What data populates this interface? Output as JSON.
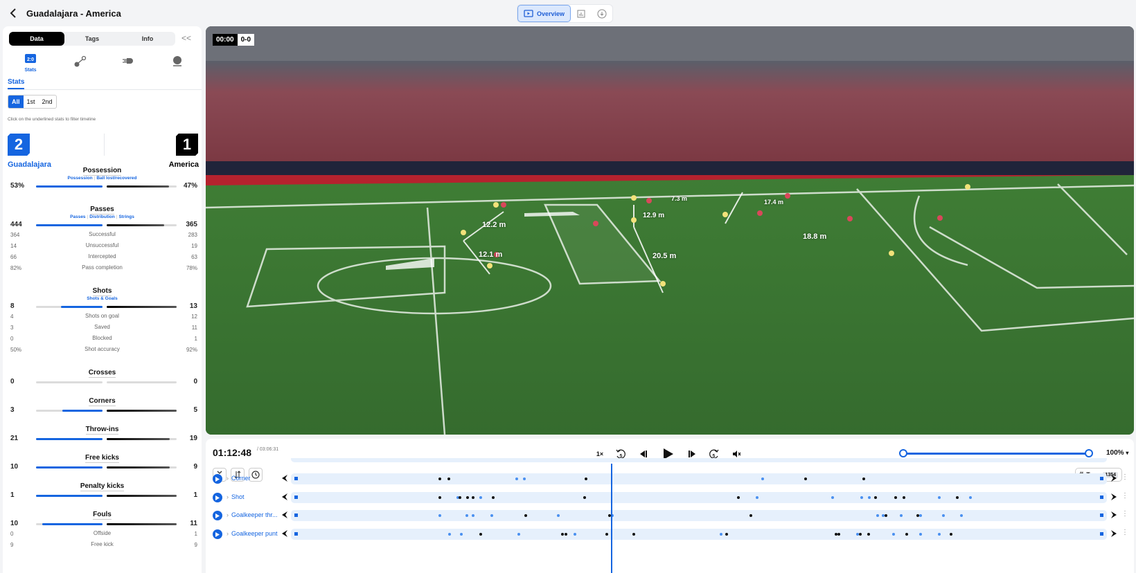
{
  "header": {
    "title": "Guadalajara - America",
    "back_label": "back"
  },
  "view_toggle": {
    "overview_label": "Overview",
    "active": "overview"
  },
  "left_panel": {
    "tabs": [
      {
        "label": "Data",
        "active": true
      },
      {
        "label": "Tags",
        "active": false
      },
      {
        "label": "Info",
        "active": false
      }
    ],
    "collapse_label": "<<",
    "categories": [
      {
        "name": "stats",
        "label": "Stats",
        "active": true
      },
      {
        "name": "passing-network"
      },
      {
        "name": "speed"
      },
      {
        "name": "player"
      }
    ],
    "section_tab": "Stats",
    "periods": [
      {
        "label": "All",
        "active": true
      },
      {
        "label": "1st",
        "active": false
      },
      {
        "label": "2nd",
        "active": false
      }
    ],
    "hint": "Click on the underlined stats to filter timeline",
    "score": {
      "home": "2",
      "away": "1",
      "home_team": "Guadalajara",
      "away_team": "America",
      "home_color": "#1565e0",
      "away_color": "#000000"
    },
    "stats": {
      "possession": {
        "title": "Possession",
        "links": [
          "Possession",
          "Ball lost/recovered"
        ],
        "home": "53%",
        "away": "47%",
        "home_frac": 1.0,
        "away_frac": 0.89
      },
      "passes": {
        "title": "Passes",
        "links": [
          "Passes",
          "Distribution",
          "Strings"
        ],
        "home": "444",
        "away": "365",
        "home_frac": 1.0,
        "away_frac": 0.82,
        "rows": [
          {
            "label": "Successful",
            "home": "364",
            "away": "283"
          },
          {
            "label": "Unsuccessful",
            "home": "14",
            "away": "19"
          },
          {
            "label": "Intercepted",
            "home": "66",
            "away": "63"
          },
          {
            "label": "Pass completion",
            "home": "82%",
            "away": "78%"
          }
        ]
      },
      "shots": {
        "title": "Shots",
        "links": [
          "Shots & Goals"
        ],
        "home": "8",
        "away": "13",
        "home_frac": 0.62,
        "away_frac": 1.0,
        "rows": [
          {
            "label": "Shots on goal",
            "home": "4",
            "away": "12"
          },
          {
            "label": "Saved",
            "home": "3",
            "away": "11"
          },
          {
            "label": "Blocked",
            "home": "0",
            "away": "1"
          },
          {
            "label": "Shot accuracy",
            "home": "50%",
            "away": "92%"
          }
        ]
      },
      "crosses": {
        "title": "Crosses",
        "home": "0",
        "away": "0",
        "home_frac": 0,
        "away_frac": 0
      },
      "corners": {
        "title": "Corners",
        "home": "3",
        "away": "5",
        "home_frac": 0.6,
        "away_frac": 1.0
      },
      "throw_ins": {
        "title": "Throw-ins",
        "home": "21",
        "away": "19",
        "home_frac": 1.0,
        "away_frac": 0.9
      },
      "free_kicks": {
        "title": "Free kicks",
        "home": "10",
        "away": "9",
        "home_frac": 1.0,
        "away_frac": 0.9
      },
      "penalty_kicks": {
        "title": "Penalty kicks",
        "home": "1",
        "away": "1",
        "home_frac": 1.0,
        "away_frac": 1.0
      },
      "fouls": {
        "title": "Fouls",
        "home": "10",
        "away": "11",
        "home_frac": 0.91,
        "away_frac": 1.0,
        "rows": [
          {
            "label": "Offside",
            "home": "0",
            "away": "1"
          },
          {
            "label": "Free kick",
            "home": "9",
            "away": "9"
          }
        ]
      }
    }
  },
  "video": {
    "clock": "00:00",
    "score": "0-0",
    "distances": [
      "12.2 m",
      "12.1 m",
      "7.3 m",
      "12.9 m",
      "20.5 m",
      "17.4 m",
      "18.8 m"
    ]
  },
  "player": {
    "current_time": "01:12:48",
    "total_time": "/ 03:06:31",
    "speed": "1×",
    "rewind_label": "5",
    "forward_label": "5",
    "zoom_pct": "100%",
    "zoom_range": [
      0,
      1
    ],
    "tags_label": "Tags",
    "tags_count": "1354",
    "playhead_frac": 0.376,
    "timeline_rows": [
      {
        "name": "Corner",
        "dots": [
          {
            "p": 0.252,
            "c": "k"
          },
          {
            "p": 0.262,
            "c": "k"
          },
          {
            "p": 0.335,
            "c": "b"
          },
          {
            "p": 0.343,
            "c": "b"
          },
          {
            "p": 0.41,
            "c": "k"
          },
          {
            "p": 0.6,
            "c": "b"
          },
          {
            "p": 0.646,
            "c": "k"
          },
          {
            "p": 0.709,
            "c": "k"
          }
        ]
      },
      {
        "name": "Shot",
        "dots": [
          {
            "p": 0.252,
            "c": "k"
          },
          {
            "p": 0.272,
            "c": "b"
          },
          {
            "p": 0.274,
            "c": "k"
          },
          {
            "p": 0.282,
            "c": "k"
          },
          {
            "p": 0.288,
            "c": "k"
          },
          {
            "p": 0.296,
            "c": "b"
          },
          {
            "p": 0.31,
            "c": "k"
          },
          {
            "p": 0.408,
            "c": "k"
          },
          {
            "p": 0.574,
            "c": "k"
          },
          {
            "p": 0.594,
            "c": "b"
          },
          {
            "p": 0.675,
            "c": "b"
          },
          {
            "p": 0.707,
            "c": "b"
          },
          {
            "p": 0.715,
            "c": "b"
          },
          {
            "p": 0.722,
            "c": "k"
          },
          {
            "p": 0.743,
            "c": "k"
          },
          {
            "p": 0.752,
            "c": "k"
          },
          {
            "p": 0.79,
            "c": "b"
          },
          {
            "p": 0.81,
            "c": "k"
          },
          {
            "p": 0.824,
            "c": "b"
          }
        ]
      },
      {
        "name": "Goalkeeper thr...",
        "dots": [
          {
            "p": 0.252,
            "c": "b"
          },
          {
            "p": 0.281,
            "c": "b"
          },
          {
            "p": 0.288,
            "c": "b"
          },
          {
            "p": 0.308,
            "c": "b"
          },
          {
            "p": 0.345,
            "c": "k"
          },
          {
            "p": 0.38,
            "c": "b"
          },
          {
            "p": 0.435,
            "c": "k"
          },
          {
            "p": 0.438,
            "c": "b"
          },
          {
            "p": 0.587,
            "c": "k"
          },
          {
            "p": 0.724,
            "c": "b"
          },
          {
            "p": 0.73,
            "c": "b"
          },
          {
            "p": 0.733,
            "c": "k"
          },
          {
            "p": 0.749,
            "c": "b"
          },
          {
            "p": 0.767,
            "c": "k"
          },
          {
            "p": 0.77,
            "c": "b"
          },
          {
            "p": 0.795,
            "c": "b"
          },
          {
            "p": 0.814,
            "c": "b"
          }
        ]
      },
      {
        "name": "Goalkeeper punt",
        "dots": [
          {
            "p": 0.263,
            "c": "b"
          },
          {
            "p": 0.275,
            "c": "b"
          },
          {
            "p": 0.296,
            "c": "k"
          },
          {
            "p": 0.337,
            "c": "b"
          },
          {
            "p": 0.384,
            "c": "k"
          },
          {
            "p": 0.388,
            "c": "k"
          },
          {
            "p": 0.398,
            "c": "b"
          },
          {
            "p": 0.432,
            "c": "k"
          },
          {
            "p": 0.461,
            "c": "k"
          },
          {
            "p": 0.555,
            "c": "b"
          },
          {
            "p": 0.561,
            "c": "k"
          },
          {
            "p": 0.679,
            "c": "k"
          },
          {
            "p": 0.682,
            "c": "k"
          },
          {
            "p": 0.702,
            "c": "b"
          },
          {
            "p": 0.705,
            "c": "k"
          },
          {
            "p": 0.714,
            "c": "k"
          },
          {
            "p": 0.741,
            "c": "b"
          },
          {
            "p": 0.755,
            "c": "k"
          },
          {
            "p": 0.77,
            "c": "b"
          },
          {
            "p": 0.79,
            "c": "b"
          },
          {
            "p": 0.803,
            "c": "k"
          }
        ]
      }
    ]
  }
}
